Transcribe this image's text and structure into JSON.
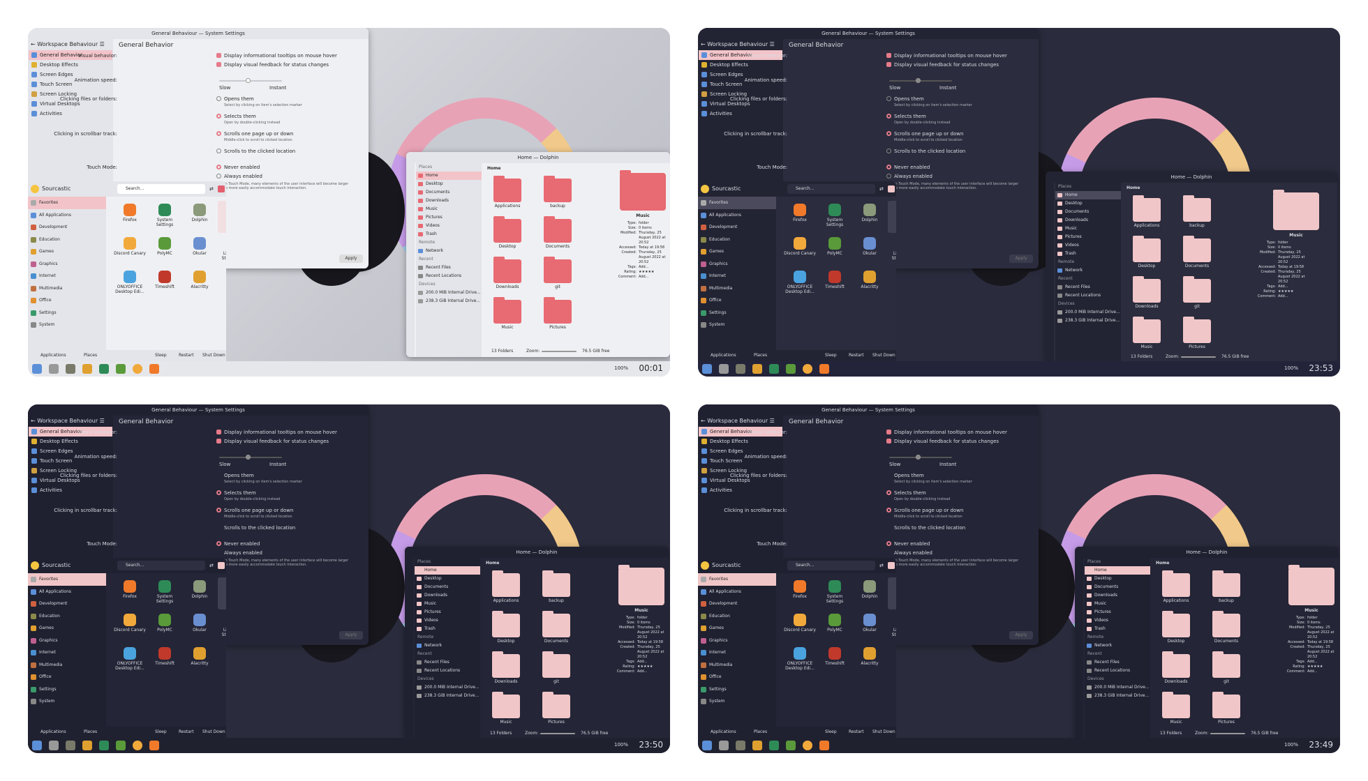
{
  "settings": {
    "title": "General Behaviour — System Settings",
    "back_label": "Workspace Behaviour",
    "page_title": "General Behavior",
    "sidebar": [
      "General Behavior",
      "Desktop Effects",
      "Screen Edges",
      "Touch Screen",
      "Screen Locking",
      "Virtual Desktops",
      "Activities"
    ],
    "visual_behavior_label": "Visual behavior:",
    "tooltips_label": "Display informational tooltips on mouse hover",
    "feedback_label": "Display visual feedback for status changes",
    "animation_label": "Animation speed:",
    "slow_label": "Slow",
    "instant_label": "Instant",
    "clicking_label": "Clicking files or folders:",
    "opens_label": "Opens them",
    "opens_sub": "Select by clicking on item's selection marker",
    "selects_label": "Selects them",
    "selects_sub": "Open by double-clicking instead",
    "scroll_label": "Clicking in scrollbar track:",
    "scroll_one": "Scrolls one page up or down",
    "scroll_one_sub": "Middle-click to scroll to clicked location",
    "scroll_to": "Scrolls to the clicked location",
    "touch_label": "Touch Mode:",
    "never_label": "Never enabled",
    "always_label": "Always enabled",
    "always_sub": "In Touch Mode, many elements of the user interface will become larger to more easily accommodate touch interaction.",
    "apply_label": "Apply"
  },
  "launcher": {
    "user": "Sourcastic",
    "search_placeholder": "Search...",
    "categories": [
      "Favorites",
      "All Applications",
      "Development",
      "Education",
      "Games",
      "Graphics",
      "Internet",
      "Multimedia",
      "Office",
      "Settings",
      "System"
    ],
    "apps": [
      {
        "name": "Firefox",
        "color": "#f07a2a"
      },
      {
        "name": "System Settings",
        "color": "#2e8b57"
      },
      {
        "name": "Dolphin",
        "color": "#8a9a7a"
      },
      {
        "name": "KWrite",
        "color": "#e8e8e8"
      },
      {
        "name": "Discord Canary",
        "color": "#f2a93b"
      },
      {
        "name": "PolyMC",
        "color": "#5a9a3a"
      },
      {
        "name": "Okular",
        "color": "#6a8fd0"
      },
      {
        "name": "LibreOffice Start Center",
        "color": "#f4f4f4"
      },
      {
        "name": "ONLYOFFICE Desktop Edi...",
        "color": "#4aa3df"
      },
      {
        "name": "Timeshift",
        "color": "#c0392b"
      },
      {
        "name": "Alacritty",
        "color": "#e0a030"
      }
    ],
    "footer": {
      "applications": "Applications",
      "places": "Places",
      "sleep": "Sleep",
      "restart": "Restart",
      "shutdown": "Shut Down"
    }
  },
  "dolphin": {
    "title": "Home — Dolphin",
    "breadcrumb": "Home",
    "places_header": "Places",
    "places": [
      "Home",
      "Desktop",
      "Documents",
      "Downloads",
      "Music",
      "Pictures",
      "Videos",
      "Trash"
    ],
    "remote_header": "Remote",
    "remote": [
      "Network"
    ],
    "recent_header": "Recent",
    "recent": [
      "Recent Files",
      "Recent Locations"
    ],
    "devices_header": "Devices",
    "devices": [
      "200.0 MiB Internal Drive...",
      "238.3 GiB Internal Drive..."
    ],
    "folders": [
      "Applications",
      "backup",
      "Desktop",
      "Documents",
      "Downloads",
      "git",
      "Music",
      "Pictures"
    ],
    "info_name": "Music",
    "info": [
      {
        "k": "Type:",
        "v": "folder"
      },
      {
        "k": "Size:",
        "v": "0 items"
      },
      {
        "k": "Modified:",
        "v": "Thursday, 25 August 2022 at 20:52"
      },
      {
        "k": "Accessed:",
        "v": "Today at 19:58"
      },
      {
        "k": "Created:",
        "v": "Thursday, 25 August 2022 at 20:52"
      },
      {
        "k": "Tags:",
        "v": "Add..."
      },
      {
        "k": "Rating:",
        "v": "★★★★★"
      },
      {
        "k": "Comment:",
        "v": "Add..."
      }
    ],
    "status_folders": "13 Folders",
    "zoom_label": "Zoom:",
    "free_space": "76.5 GiB free"
  },
  "panel": {
    "battery": "100%",
    "clocks": [
      "00:01",
      "23:53",
      "23:50",
      "23:49"
    ]
  },
  "themes": [
    {
      "wall": "#c9cbd2",
      "win": "#eff0f3",
      "side": "#e3e5ea",
      "text": "#2a2a2a",
      "sel": "#f2c4c9",
      "panel": "#e6e7eb",
      "folder": "#e86a72",
      "outer": "#f6f6f6"
    },
    {
      "wall": "#2a2b3c",
      "win": "#2b2c3d",
      "side": "#232433",
      "text": "#dcdce4",
      "sel": "#4a4a5c",
      "panel": "#23243a",
      "folder": "#f1c6c8",
      "outer": "#20212f"
    },
    {
      "wall": "#2a2b3c",
      "win": "#242536",
      "side": "#1f2030",
      "text": "#dcdce4",
      "sel": "#f1c6c8",
      "panel": "#20212f",
      "folder": "#f1c6c8",
      "outer": "#20212f"
    },
    {
      "wall": "#2a2b3c",
      "win": "#242536",
      "side": "#1f2030",
      "text": "#dcdce4",
      "sel": "#f1c6c8",
      "panel": "#20212f",
      "folder": "#f1c6c8",
      "outer": "#20212f"
    }
  ]
}
